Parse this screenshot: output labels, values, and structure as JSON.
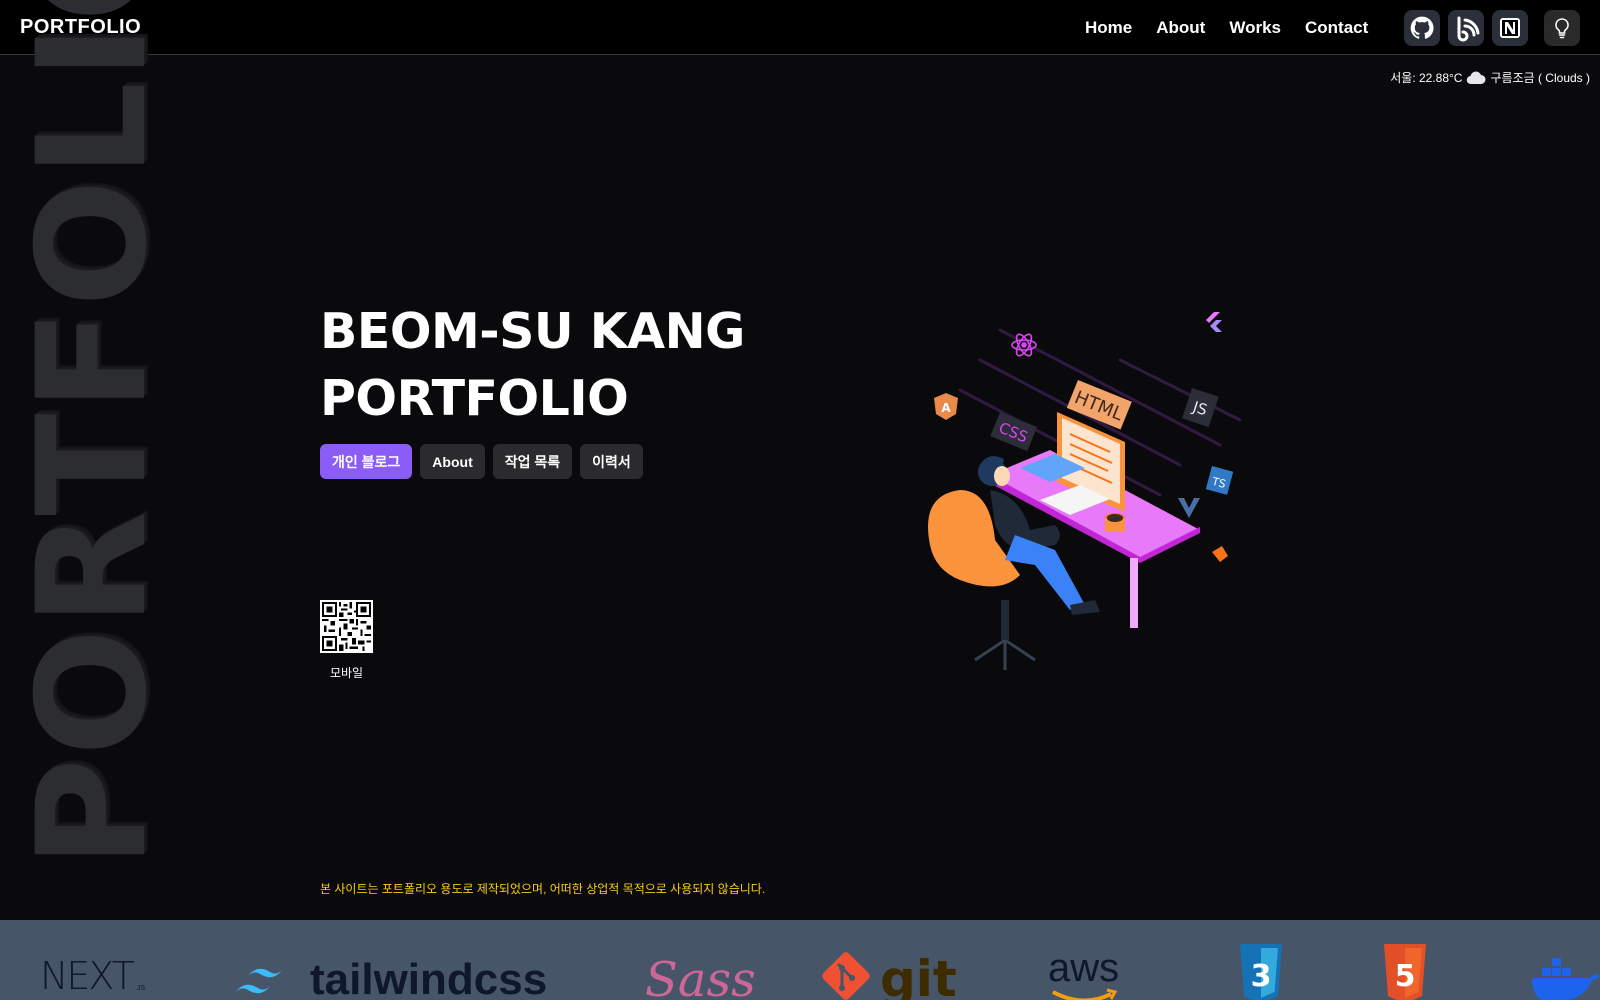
{
  "header": {
    "logo": "PORTFOLIO",
    "nav": [
      {
        "label": "Home"
      },
      {
        "label": "About"
      },
      {
        "label": "Works"
      },
      {
        "label": "Contact"
      }
    ]
  },
  "weather": {
    "text": "서울: 22.88°C",
    "condition": "구름조금 ( Clouds )"
  },
  "side_word": "PORTFOLIO",
  "hero": {
    "name": "BEOM-SU KANG",
    "subtitle": "PORTFOLIO",
    "buttons": [
      {
        "label": "개인 블로그"
      },
      {
        "label": "About"
      },
      {
        "label": "작업 목록"
      },
      {
        "label": "이력서"
      }
    ],
    "qr_label": "모바일",
    "notice": "본 사이트는 포트폴리오 용도로 제작되었으며, 어떠한 상업적 목적으로 사용되지 않습니다."
  },
  "tech": {
    "next": "NEXT",
    "next_sub": ".JS",
    "tailwind": "tailwindcss",
    "sass": "Sass",
    "git": "git",
    "aws": "aws"
  },
  "illustration": {
    "html": "HTML",
    "css": "CSS",
    "js": "JS",
    "ts": "TS",
    "angular": "A"
  },
  "colors": {
    "accent": "#8b5cf6",
    "notice": "#facc15",
    "tech_band": "#475569"
  }
}
